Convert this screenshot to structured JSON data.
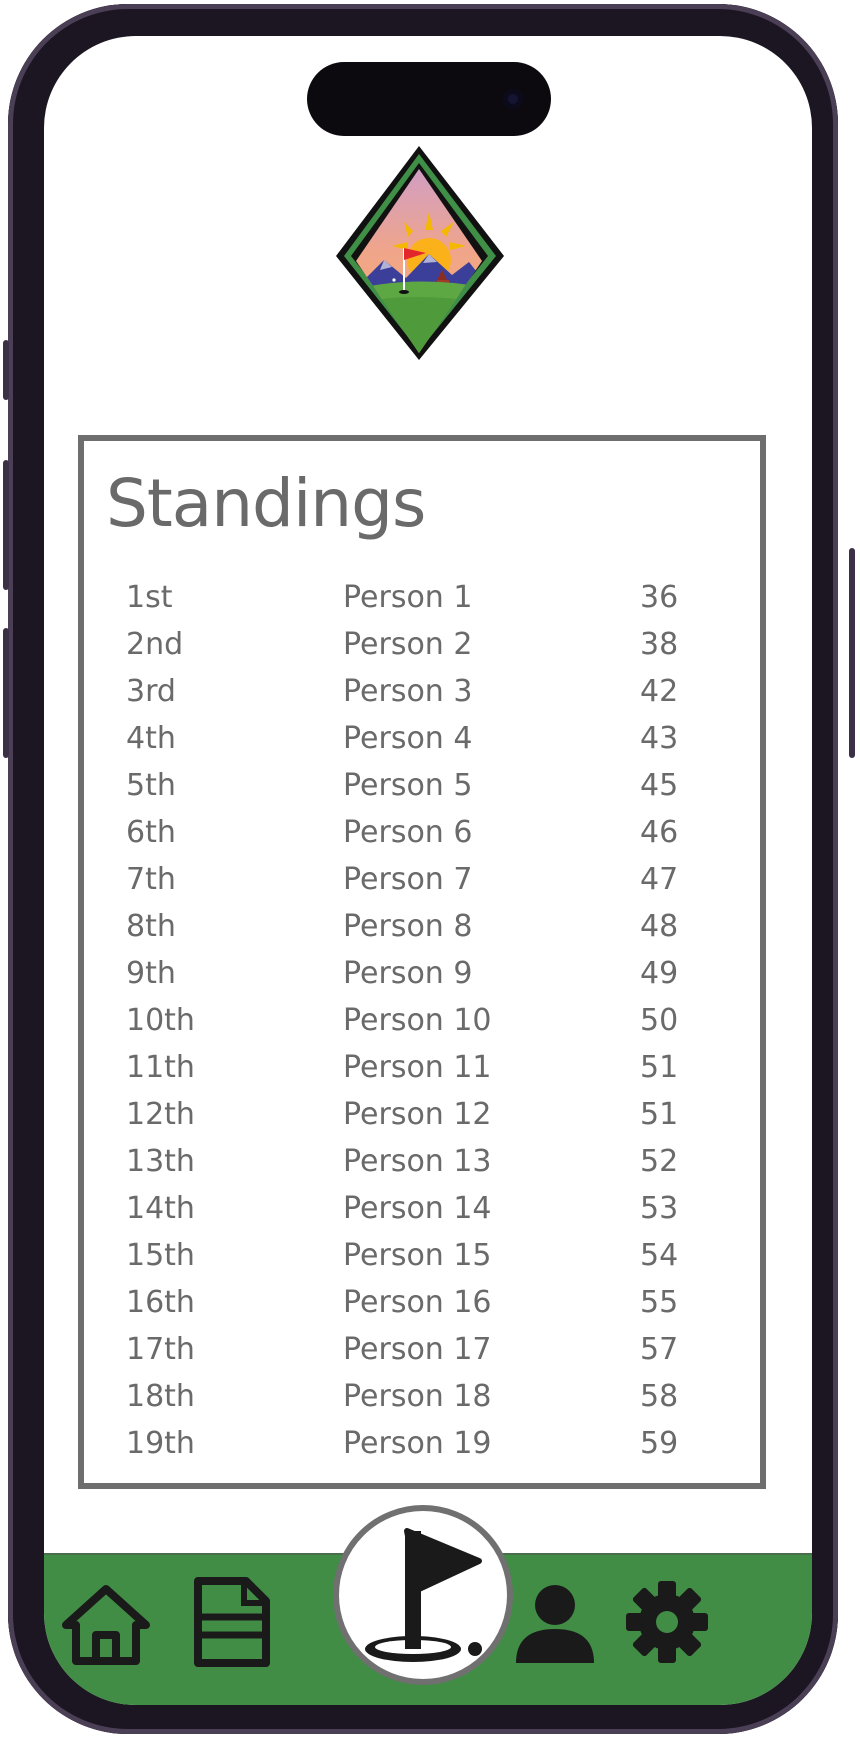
{
  "standings": {
    "title": "Standings",
    "rows": [
      {
        "rank": "1st",
        "name": "Person 1",
        "score": "36"
      },
      {
        "rank": "2nd",
        "name": "Person 2",
        "score": "38"
      },
      {
        "rank": "3rd",
        "name": "Person 3",
        "score": "42"
      },
      {
        "rank": "4th",
        "name": "Person 4",
        "score": "43"
      },
      {
        "rank": "5th",
        "name": "Person 5",
        "score": "45"
      },
      {
        "rank": "6th",
        "name": "Person 6",
        "score": "46"
      },
      {
        "rank": "7th",
        "name": "Person 7",
        "score": "47"
      },
      {
        "rank": "8th",
        "name": "Person 8",
        "score": "48"
      },
      {
        "rank": "9th",
        "name": "Person 9",
        "score": "49"
      },
      {
        "rank": "10th",
        "name": "Person 10",
        "score": "50"
      },
      {
        "rank": "11th",
        "name": "Person 11",
        "score": "51"
      },
      {
        "rank": "12th",
        "name": "Person 12",
        "score": "51"
      },
      {
        "rank": "13th",
        "name": "Person 13",
        "score": "52"
      },
      {
        "rank": "14th",
        "name": "Person 14",
        "score": "53"
      },
      {
        "rank": "15th",
        "name": "Person 15",
        "score": "54"
      },
      {
        "rank": "16th",
        "name": "Person 16",
        "score": "55"
      },
      {
        "rank": "17th",
        "name": "Person 17",
        "score": "57"
      },
      {
        "rank": "18th",
        "name": "Person 18",
        "score": "58"
      },
      {
        "rank": "19th",
        "name": "Person 19",
        "score": "59"
      }
    ]
  },
  "nav": {
    "items": [
      {
        "icon": "home-icon"
      },
      {
        "icon": "document-icon"
      },
      {
        "icon": "golf-flag-hole-icon"
      },
      {
        "icon": "person-icon"
      },
      {
        "icon": "gear-icon"
      }
    ]
  },
  "colors": {
    "nav_background": "#418d45",
    "text": "#6a6a6a",
    "card_border": "#6e6e6e",
    "phone_frame": "#1c1522"
  }
}
